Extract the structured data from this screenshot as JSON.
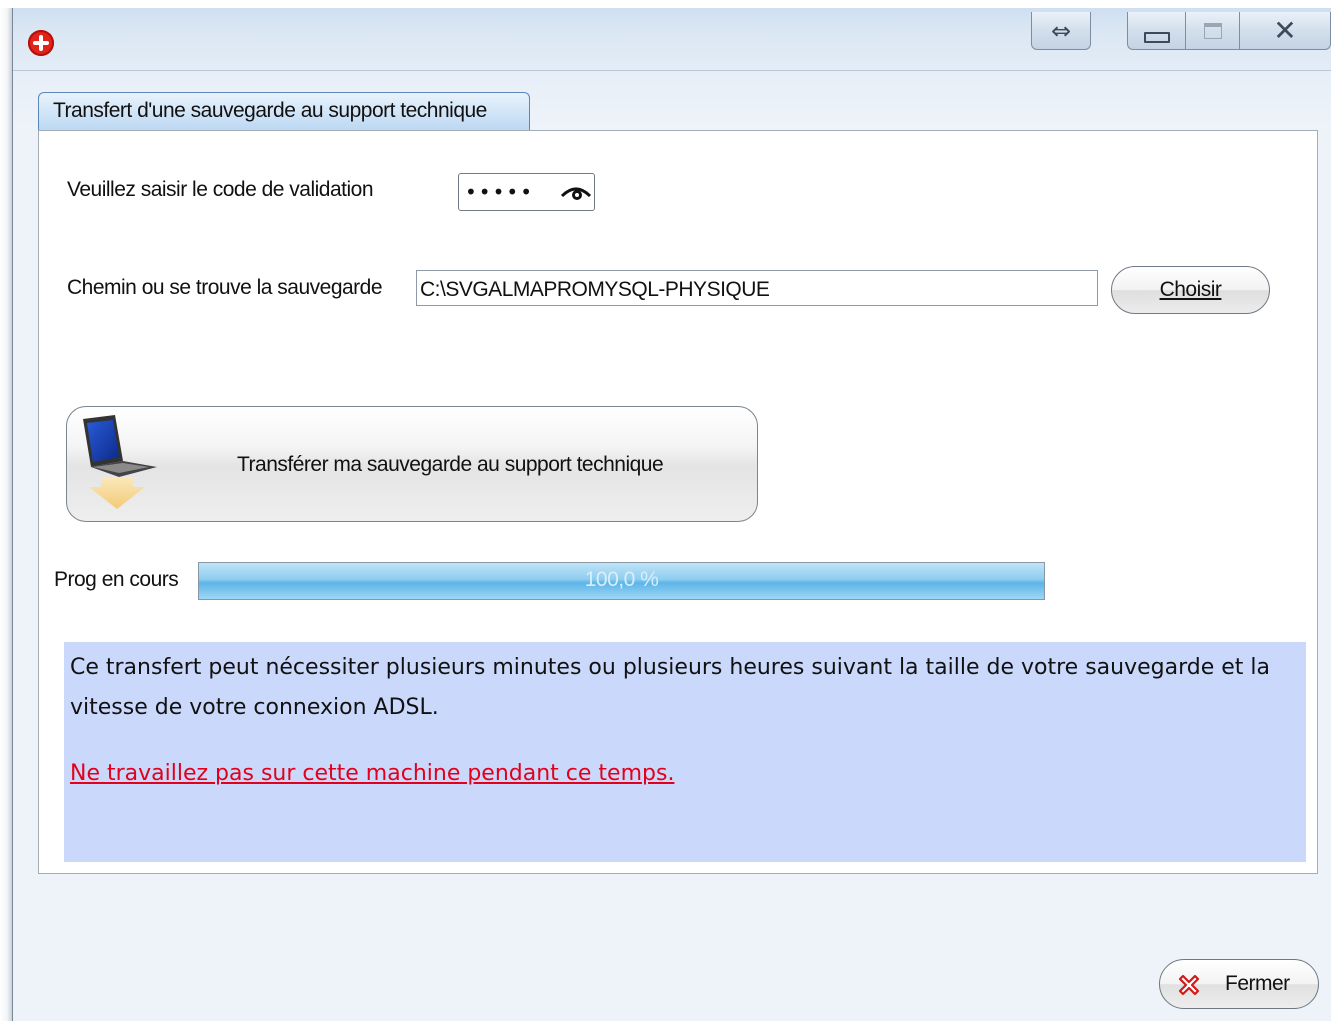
{
  "window": {
    "title": "",
    "controls": {
      "resize_icon": "double-arrow-icon",
      "minimize_icon": "minimize-icon",
      "maximize_icon": "maximize-icon",
      "close_icon": "close-x-icon"
    }
  },
  "tab": {
    "label": "Transfert d'une sauvegarde au support technique"
  },
  "validation": {
    "label": "Veuillez saisir le code de validation",
    "masked_value": "•••••",
    "reveal_icon": "eye-icon"
  },
  "path": {
    "label": "Chemin ou se trouve la sauvegarde",
    "value": "C:\\SVGALMAPROMYSQL-PHYSIQUE",
    "choose_button": "Choisir"
  },
  "transfer": {
    "button_label": "Transférer ma sauvegarde au support technique",
    "icon": "laptop-upload-icon"
  },
  "progress": {
    "label": "Prog en cours",
    "value_text": "100,0 %",
    "fraction": 1.0
  },
  "info": {
    "message": "Ce transfert peut nécessiter plusieurs minutes ou plusieurs heures suivant la taille de votre sauvegarde et la vitesse de votre connexion ADSL.",
    "warning": "Ne travaillez pas sur cette machine pendant ce temps."
  },
  "footer": {
    "close_button": "Fermer",
    "close_icon": "red-x-icon"
  },
  "colors": {
    "accent_tab": "#bcd8f3",
    "info_bg": "#cad9fb",
    "warning": "#e3001b",
    "progress_fill": "#5db5e8"
  }
}
